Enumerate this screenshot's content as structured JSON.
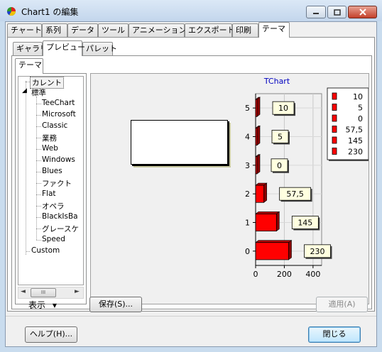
{
  "window": {
    "title": "Chart1 の編集",
    "icon": "teechart-app-icon"
  },
  "main_tabs": [
    "チャート",
    "系列",
    "データ",
    "ツール",
    "アニメーション",
    "エクスポート",
    "印刷",
    "テーマ"
  ],
  "main_tab_active": "テーマ",
  "sub_tabs": [
    "ギャラリ",
    "プレビュー",
    "パレット"
  ],
  "sub_tab_active": "プレビュー",
  "tree_tab": "テーマ",
  "tree": {
    "current": "カレント",
    "group": "標準",
    "children": [
      "TeeChart",
      "Microsoft",
      "Classic",
      "業務",
      "Web",
      "Windows",
      "Blues",
      "ファクト",
      "Flat",
      "オペラ",
      "BlackIsBa",
      "グレースケ",
      "Speed"
    ],
    "last": "Custom"
  },
  "scrollbar": {
    "grip": "III"
  },
  "chart_data": {
    "type": "bar",
    "orientation": "horizontal",
    "title": "TChart",
    "categories": [
      "0",
      "1",
      "2",
      "3",
      "4",
      "5"
    ],
    "values": [
      230,
      145,
      57.5,
      0,
      5,
      10
    ],
    "value_labels": [
      "230",
      "145",
      "57,5",
      "0",
      "5",
      "10"
    ],
    "x_ticks": [
      "0",
      "200",
      "400"
    ],
    "xlim": [
      0,
      460
    ],
    "legend": [
      "10",
      "5",
      "0",
      "57,5",
      "145",
      "230"
    ],
    "legend_position": "right",
    "bar_color": "#ff0000",
    "title_color": "#0000c0",
    "label_bg": "#ffffe0",
    "grid": true
  },
  "footer": {
    "show_label": "表示",
    "save_button": "保存(S)...",
    "apply_button": "適用(A)"
  },
  "bottom": {
    "help_button": "ヘルプ(H)...",
    "close_button": "閉じる"
  }
}
